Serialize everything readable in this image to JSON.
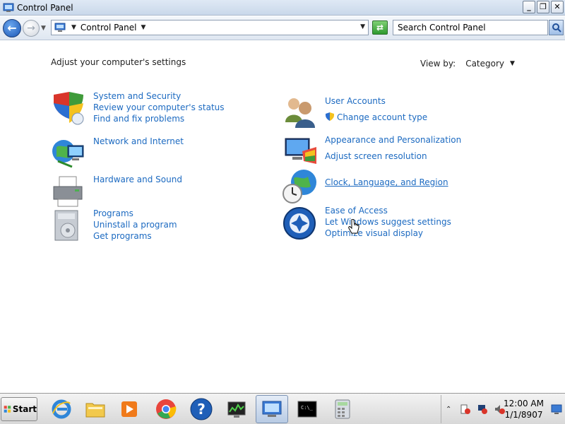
{
  "window": {
    "title": "Control Panel",
    "controls": {
      "minimize": "_",
      "restore": "❐",
      "close": "✕"
    }
  },
  "address_bar": {
    "crumb": "Control Panel",
    "search_placeholder": "Search Control Panel"
  },
  "main": {
    "heading": "Adjust your computer's settings",
    "view_by_label": "View by:",
    "view_by_value": "Category",
    "categories_left": [
      {
        "icon": "shield-icon",
        "title": "System and Security",
        "links": [
          "Review your computer's status",
          "Find and fix problems"
        ]
      },
      {
        "icon": "network-icon",
        "title": "Network and Internet",
        "links": []
      },
      {
        "icon": "printer-icon",
        "title": "Hardware and Sound",
        "links": []
      },
      {
        "icon": "programs-icon",
        "title": "Programs",
        "links": [
          "Uninstall a program",
          "Get programs"
        ]
      }
    ],
    "categories_right": [
      {
        "icon": "users-icon",
        "title": "User Accounts",
        "links": [
          "Change account type"
        ]
      },
      {
        "icon": "display-icon",
        "title": "Appearance and Personalization",
        "links": [
          "Adjust screen resolution"
        ]
      },
      {
        "icon": "globe-clock-icon",
        "title": "Clock, Language, and Region",
        "links": []
      },
      {
        "icon": "ease-of-access-icon",
        "title": "Ease of Access",
        "links": [
          "Let Windows suggest settings",
          "Optimize visual display"
        ]
      }
    ]
  },
  "taskbar": {
    "start_label": "Start",
    "apps": [
      "internet-explorer-icon",
      "explorer-folder-icon",
      "media-player-icon",
      "chrome-icon",
      "help-icon",
      "task-manager-icon",
      "control-panel-icon",
      "cmd-icon",
      "calculator-icon"
    ],
    "clock_time": "12:00 AM",
    "clock_date": "1/1/8907"
  },
  "colors": {
    "link": "#1c6ac1",
    "taskbar_active": "#b8cbe4"
  }
}
